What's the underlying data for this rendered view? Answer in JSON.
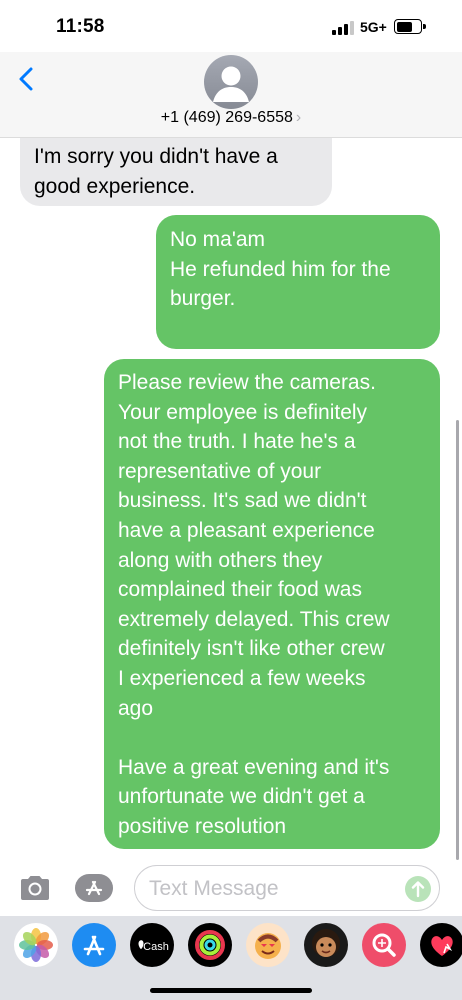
{
  "status_bar": {
    "time": "11:58",
    "network": "5G+"
  },
  "header": {
    "contact": "+1 (469) 269-6558",
    "chevron": "›"
  },
  "messages": [
    {
      "side": "incoming",
      "text": "I'm sorry you didn't have a\ngood experience."
    },
    {
      "side": "outgoing",
      "text": "No ma'am\nHe refunded him for the\nburger."
    },
    {
      "side": "outgoing",
      "text": "Please review the cameras.\nYour employee is definitely\nnot the truth. I hate he's a\nrepresentative of your\nbusiness. It's sad we didn't\nhave a pleasant experience\nalong with others they\ncomplained their food was\nextremely delayed. This crew\ndefinitely isn't like other crew\nI experienced a few weeks\nago\n\nHave a great evening and it's\nunfortunate we didn't get a\npositive resolution"
    }
  ],
  "input": {
    "placeholder": "Text Message"
  },
  "app_tray": [
    {
      "name": "photos-app",
      "label": ""
    },
    {
      "name": "app-store-app",
      "label": ""
    },
    {
      "name": "apple-cash-app",
      "label": "Cash"
    },
    {
      "name": "activity-app",
      "label": ""
    },
    {
      "name": "memoji-stickers-app",
      "label": ""
    },
    {
      "name": "animoji-app",
      "label": ""
    },
    {
      "name": "images-search-app",
      "label": ""
    },
    {
      "name": "digital-touch-app",
      "label": ""
    }
  ],
  "colors": {
    "outgoing_bubble": "#65c466",
    "incoming_bubble": "#e9e9eb",
    "accent": "#007aff"
  }
}
